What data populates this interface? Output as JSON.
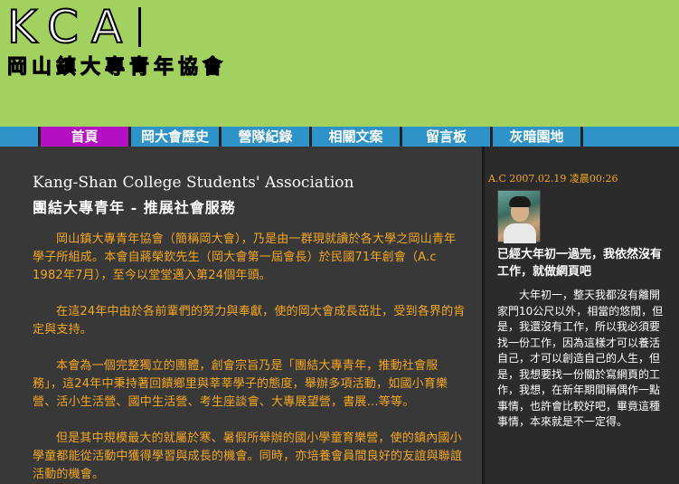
{
  "header": {
    "logo_text": "KCA",
    "subtitle": "岡山鎮大專青年協會"
  },
  "nav": {
    "items": [
      {
        "label": "首頁",
        "active": true
      },
      {
        "label": "岡大會歷史",
        "active": false
      },
      {
        "label": "營隊紀錄",
        "active": false
      },
      {
        "label": "相關文案",
        "active": false
      },
      {
        "label": "留言板",
        "active": false
      },
      {
        "label": "灰暗園地",
        "active": false
      }
    ]
  },
  "main": {
    "title_en": "Kang-Shan College Students' Association",
    "title_zh": "團結大專青年 - 推展社會服務",
    "paragraphs": [
      "岡山鎮大專青年協會（簡稱岡大會），乃是由一群現就讀於各大學之岡山青年學子所組成。本會自蔣榮欽先生（岡大會第一屆會長）於民國71年創會（A.c 1982年7月），至今以堂堂邁入第24個年頭。",
      "在這24年中由於各前輩們的努力與奉獻，使的岡大會成長茁壯，受到各界的肯定與支持。",
      "本會為一個完整獨立的團體，創會宗旨乃是「團結大專青年，推動社會服務」，這24年中秉持著回饋鄉里與莘莘學子的態度，舉辦多項活動，如國小育樂營、活小生活營、國中生活營、考生座談會、大專展望營，書展…等等。",
      "但是其中規模最大的就屬於寒、暑假所舉辦的國小學童育樂營，使的鎮內國小學童都能從活動中獲得學習與成長的機會。同時，亦培養會員間良好的友誼與聯誼活動的機會。"
    ]
  },
  "sidebar": {
    "date": "A.C 2007.02.19 凌晨00:26",
    "post_title": "已經大年初一過完，我依然沒有工作，就做網頁吧",
    "post_body": "大年初一，整天我都沒有離開家門10公尺以外，相當的悠閒，但是，我還沒有工作，所以我必須要找一份工作，因為這樣才可以養活自己，才可以創造自己的人生，但是，我想要找一份關於寫網頁的工作，我想，在新年期間稱偶作一點事情，也許會比較好吧，畢竟這種事情，本來就是不一定得。"
  },
  "colors": {
    "header_bg": "#a3d160",
    "nav_bg": "#2e93c8",
    "nav_active": "#b40fc2",
    "body_text": "#f5a820",
    "main_bg": "#383838"
  }
}
